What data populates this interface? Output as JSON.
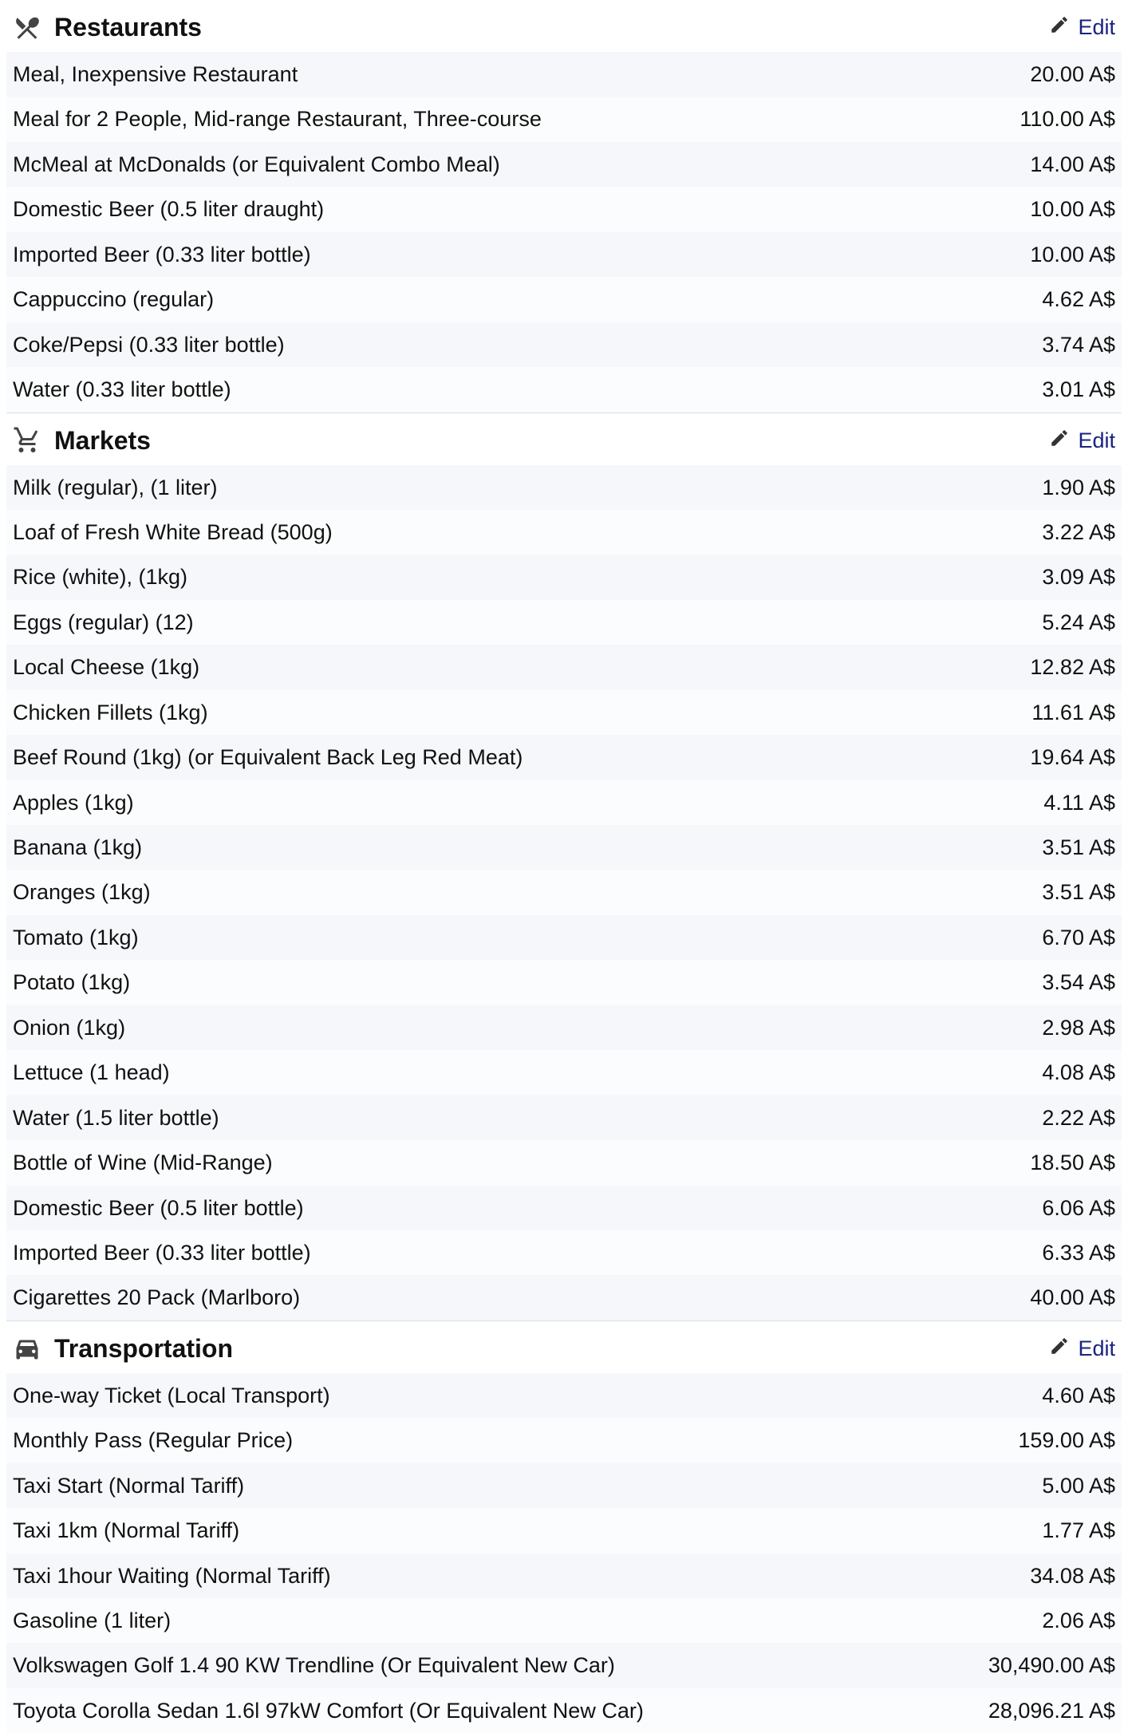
{
  "edit_label": "Edit",
  "currency_suffix": "A$",
  "sections": [
    {
      "id": "restaurants",
      "title": "Restaurants",
      "icon": "restaurant-icon",
      "items": [
        {
          "label": "Meal, Inexpensive Restaurant",
          "value": "20.00 A$"
        },
        {
          "label": "Meal for 2 People, Mid-range Restaurant, Three-course",
          "value": "110.00 A$"
        },
        {
          "label": "McMeal at McDonalds (or Equivalent Combo Meal)",
          "value": "14.00 A$"
        },
        {
          "label": "Domestic Beer (0.5 liter draught)",
          "value": "10.00 A$"
        },
        {
          "label": "Imported Beer (0.33 liter bottle)",
          "value": "10.00 A$"
        },
        {
          "label": "Cappuccino (regular)",
          "value": "4.62 A$"
        },
        {
          "label": "Coke/Pepsi (0.33 liter bottle)",
          "value": "3.74 A$"
        },
        {
          "label": "Water (0.33 liter bottle)",
          "value": "3.01 A$"
        }
      ]
    },
    {
      "id": "markets",
      "title": "Markets",
      "icon": "cart-icon",
      "items": [
        {
          "label": "Milk (regular), (1 liter)",
          "value": "1.90 A$"
        },
        {
          "label": "Loaf of Fresh White Bread (500g)",
          "value": "3.22 A$"
        },
        {
          "label": "Rice (white), (1kg)",
          "value": "3.09 A$"
        },
        {
          "label": "Eggs (regular) (12)",
          "value": "5.24 A$"
        },
        {
          "label": "Local Cheese (1kg)",
          "value": "12.82 A$"
        },
        {
          "label": "Chicken Fillets (1kg)",
          "value": "11.61 A$"
        },
        {
          "label": "Beef Round (1kg) (or Equivalent Back Leg Red Meat)",
          "value": "19.64 A$"
        },
        {
          "label": "Apples (1kg)",
          "value": "4.11 A$"
        },
        {
          "label": "Banana (1kg)",
          "value": "3.51 A$"
        },
        {
          "label": "Oranges (1kg)",
          "value": "3.51 A$"
        },
        {
          "label": "Tomato (1kg)",
          "value": "6.70 A$"
        },
        {
          "label": "Potato (1kg)",
          "value": "3.54 A$"
        },
        {
          "label": "Onion (1kg)",
          "value": "2.98 A$"
        },
        {
          "label": "Lettuce (1 head)",
          "value": "4.08 A$"
        },
        {
          "label": "Water (1.5 liter bottle)",
          "value": "2.22 A$"
        },
        {
          "label": "Bottle of Wine (Mid-Range)",
          "value": "18.50 A$"
        },
        {
          "label": "Domestic Beer (0.5 liter bottle)",
          "value": "6.06 A$"
        },
        {
          "label": "Imported Beer (0.33 liter bottle)",
          "value": "6.33 A$"
        },
        {
          "label": "Cigarettes 20 Pack (Marlboro)",
          "value": "40.00 A$"
        }
      ]
    },
    {
      "id": "transportation",
      "title": "Transportation",
      "icon": "car-icon",
      "items": [
        {
          "label": "One-way Ticket (Local Transport)",
          "value": "4.60 A$"
        },
        {
          "label": "Monthly Pass (Regular Price)",
          "value": "159.00 A$"
        },
        {
          "label": "Taxi Start (Normal Tariff)",
          "value": "5.00 A$"
        },
        {
          "label": "Taxi 1km (Normal Tariff)",
          "value": "1.77 A$"
        },
        {
          "label": "Taxi 1hour Waiting (Normal Tariff)",
          "value": "34.08 A$"
        },
        {
          "label": "Gasoline (1 liter)",
          "value": "2.06 A$"
        },
        {
          "label": "Volkswagen Golf 1.4 90 KW Trendline (Or Equivalent New Car)",
          "value": "30,490.00 A$"
        },
        {
          "label": "Toyota Corolla Sedan 1.6l 97kW Comfort (Or Equivalent New Car)",
          "value": "28,096.21 A$"
        }
      ]
    }
  ]
}
